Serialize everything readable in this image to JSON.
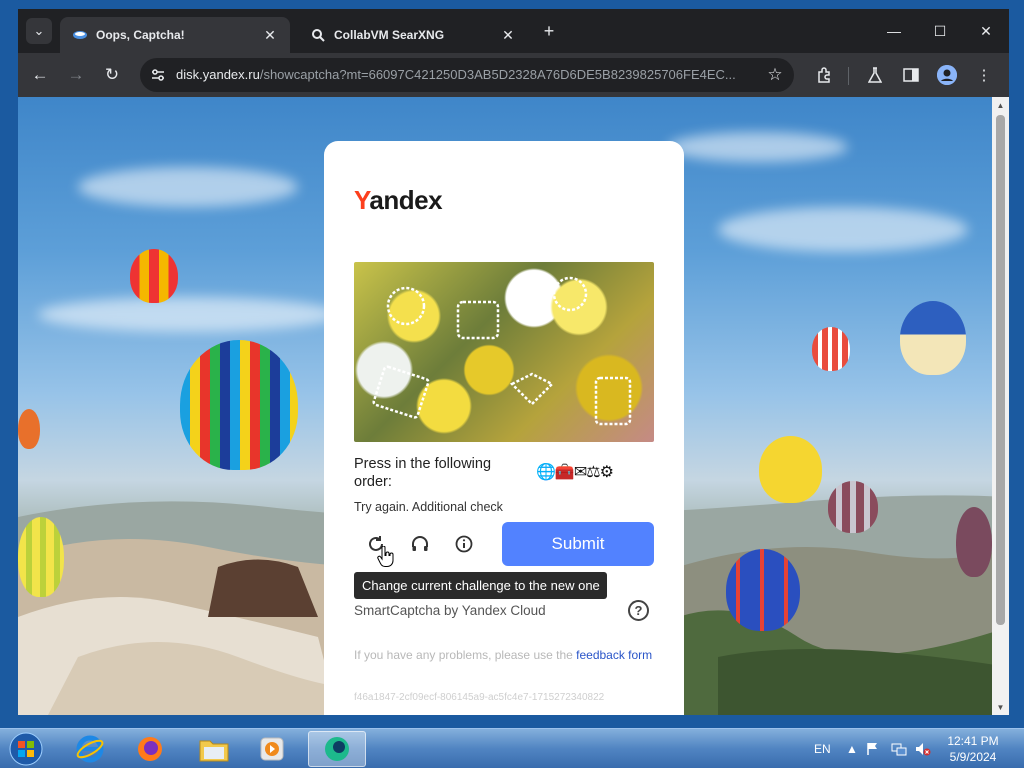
{
  "browser": {
    "tabs": [
      {
        "title": "Oops, Captcha!",
        "active": true
      },
      {
        "title": "CollabVM SearXNG",
        "active": false
      }
    ],
    "url_host": "disk.yandex.ru",
    "url_rest": "/showcaptcha?mt=66097C421250D3AB5D2328A76D6DE5B8239825706FE4EC...",
    "icons": [
      "tab-search-icon",
      "back-icon",
      "forward-icon",
      "reload-icon",
      "site-info-icon",
      "bookmark-star-icon",
      "extensions-icon",
      "labs-icon",
      "side-panel-icon",
      "profile-icon",
      "menu-icon"
    ]
  },
  "captcha": {
    "logo_first": "Y",
    "logo_rest": "andex",
    "instruction": "Press in the following order:",
    "order_icons": "🌐🧰✉⚖⚙",
    "status": "Try again. Additional check",
    "submit_label": "Submit",
    "tooltip": "Change current challenge to the new one",
    "brand": "SmartCaptcha by Yandex Cloud",
    "help": "?",
    "feedback_text": "If you have any problems, please use the ",
    "feedback_link": "feedback form",
    "request_id": "f46a1847-2cf09ecf-806145a9-ac5fc4e7-1715272340822"
  },
  "taskbar": {
    "language": "EN",
    "time": "12:41 PM",
    "date": "5/9/2024",
    "apps": [
      "internet-explorer",
      "firefox",
      "file-explorer",
      "media-player",
      "collabvm-app"
    ]
  }
}
